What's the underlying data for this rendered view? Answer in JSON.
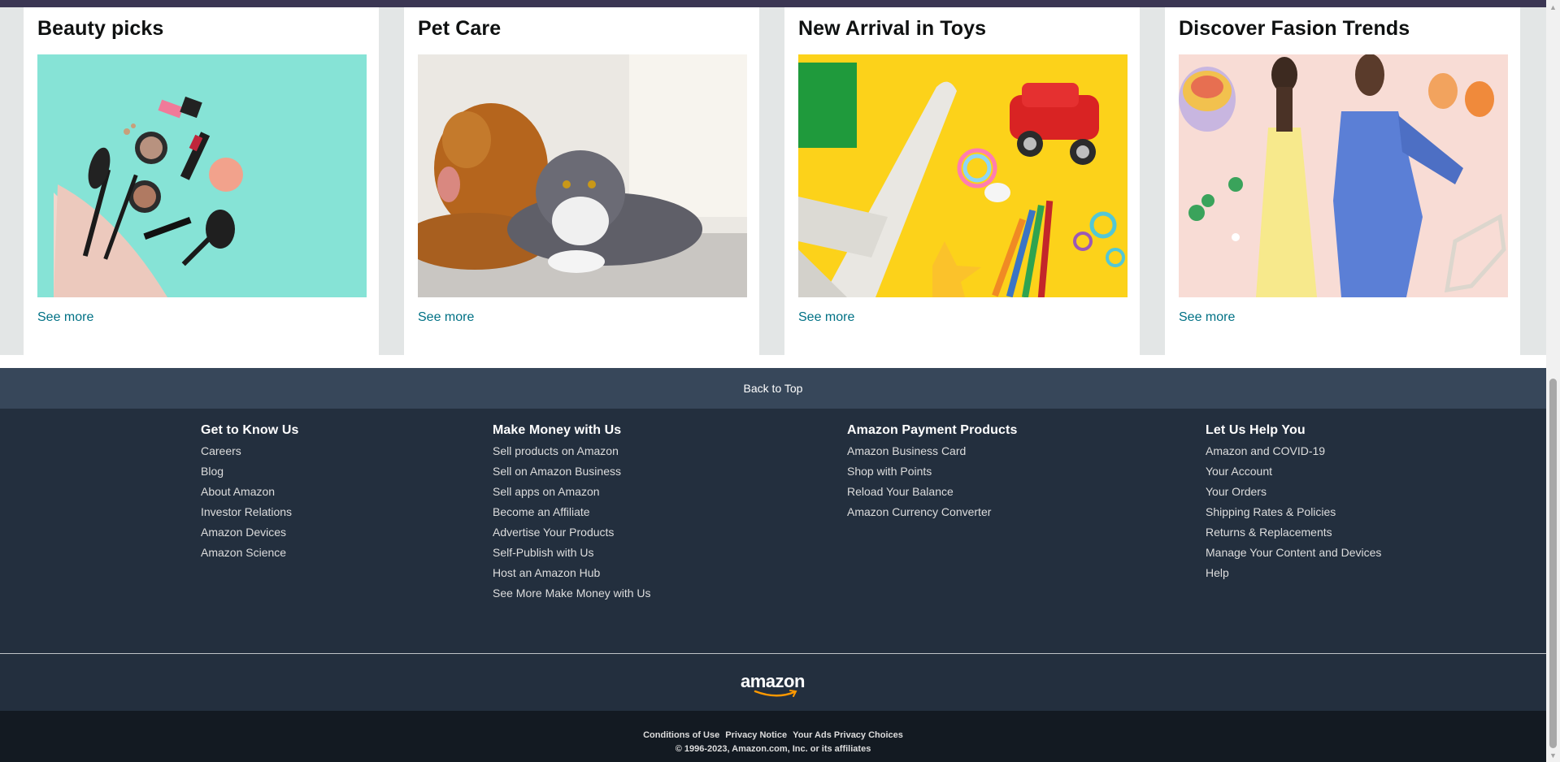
{
  "cards": [
    {
      "title": "Beauty picks",
      "link": "See more",
      "image": "cosmetics-bag-photo"
    },
    {
      "title": "Pet Care",
      "link": "See more",
      "image": "dog-and-cat-photo"
    },
    {
      "title": "New Arrival in Toys",
      "link": "See more",
      "image": "toys-photo"
    },
    {
      "title": "Discover Fasion Trends",
      "link": "See more",
      "image": "fashion-photo"
    }
  ],
  "back_to_top": "Back to Top",
  "footer": {
    "columns": [
      {
        "heading": "Get to Know Us",
        "links": [
          "Careers",
          "Blog",
          "About Amazon",
          "Investor Relations",
          "Amazon Devices",
          "Amazon Science"
        ]
      },
      {
        "heading": "Make Money with Us",
        "links": [
          "Sell products on Amazon",
          "Sell on Amazon Business",
          "Sell apps on Amazon",
          "Become an Affiliate",
          "Advertise Your Products",
          "Self-Publish with Us",
          "Host an Amazon Hub",
          "See More Make Money with Us"
        ]
      },
      {
        "heading": "Amazon Payment Products",
        "links": [
          "Amazon Business Card",
          "Shop with Points",
          "Reload Your Balance",
          "Amazon Currency Converter"
        ]
      },
      {
        "heading": "Let Us Help You",
        "links": [
          "Amazon and COVID-19",
          "Your Account",
          "Your Orders",
          "Shipping Rates & Policies",
          "Returns & Replacements",
          "Manage Your Content and Devices",
          "Help"
        ]
      }
    ],
    "logo": "amazon",
    "bottom_links": [
      "Conditions of Use",
      "Privacy Notice",
      "Your Ads Privacy Choices"
    ],
    "copyright": "© 1996-2023, Amazon.com, Inc. or its affiliates"
  },
  "colors": {
    "link": "#007185",
    "footer_bg": "#232f3e",
    "back_to_top_bg": "#37475a",
    "bottom_bg": "#131a22",
    "logo_smile": "#ff9900"
  }
}
